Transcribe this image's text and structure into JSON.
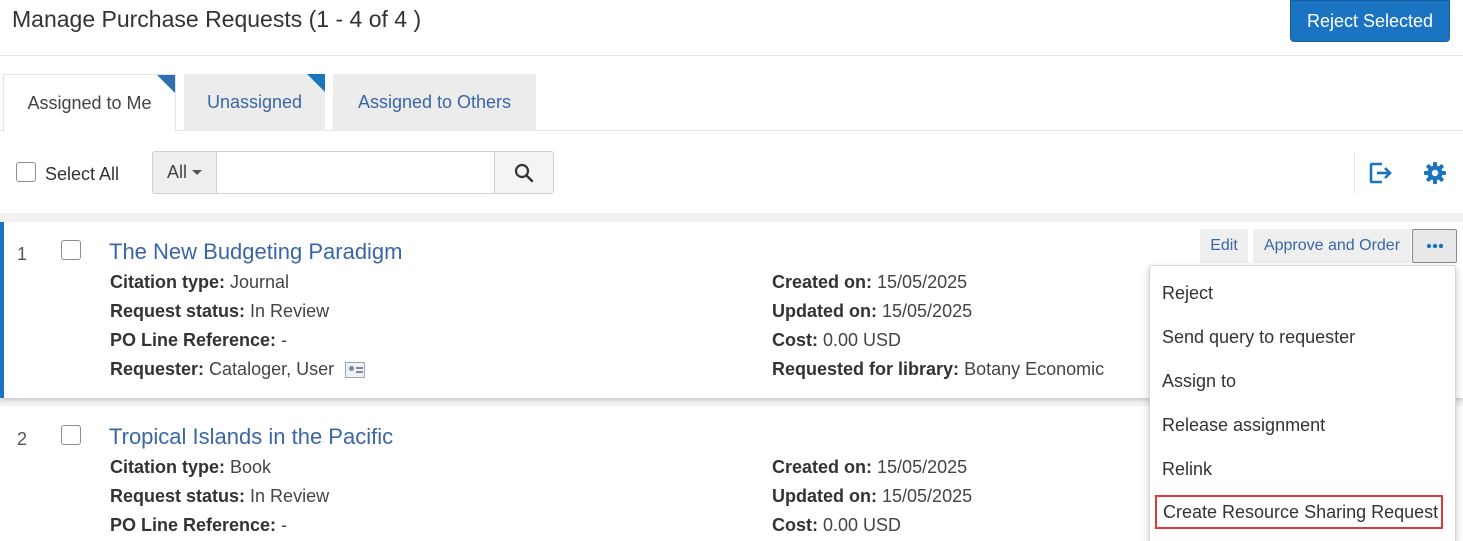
{
  "header": {
    "title": "Manage Purchase Requests (1 - 4 of 4 )",
    "reject_selected_label": "Reject Selected"
  },
  "tabs": [
    {
      "label": "Assigned to Me",
      "active": true
    },
    {
      "label": "Unassigned",
      "active": false
    },
    {
      "label": "Assigned to Others",
      "active": false
    }
  ],
  "toolbar": {
    "select_all_label": "Select All",
    "search_scope": "All",
    "search_value": "",
    "search_placeholder": ""
  },
  "records": [
    {
      "number": "1",
      "title": "The New Budgeting Paradigm",
      "citation_type_label": "Citation type:",
      "citation_type": "Journal",
      "request_status_label": "Request status:",
      "request_status": "In Review",
      "po_line_label": "PO Line Reference:",
      "po_line": "-",
      "requester_label": "Requester:",
      "requester": "Cataloger, User",
      "created_label": "Created on:",
      "created": "15/05/2025",
      "updated_label": "Updated on:",
      "updated": "15/05/2025",
      "cost_label": "Cost:",
      "cost": "0.00 USD",
      "library_label": "Requested for library:",
      "library": "Botany Economic",
      "actions": {
        "edit": "Edit",
        "approve": "Approve and Order"
      }
    },
    {
      "number": "2",
      "title": "Tropical Islands in the Pacific",
      "citation_type_label": "Citation type:",
      "citation_type": "Book",
      "request_status_label": "Request status:",
      "request_status": "In Review",
      "po_line_label": "PO Line Reference:",
      "po_line": "-",
      "created_label": "Created on:",
      "created": "15/05/2025",
      "updated_label": "Updated on:",
      "updated": "15/05/2025",
      "cost_label": "Cost:",
      "cost": "0.00 USD"
    }
  ],
  "actions_menu": {
    "items": [
      "Reject",
      "Send query to requester",
      "Assign to",
      "Release assignment",
      "Relink",
      "Create Resource Sharing Request"
    ],
    "highlighted_index": 5
  },
  "colors": {
    "accent": "#1a74c2",
    "link": "#3a66a8",
    "highlight_outline": "#d93a3a"
  }
}
